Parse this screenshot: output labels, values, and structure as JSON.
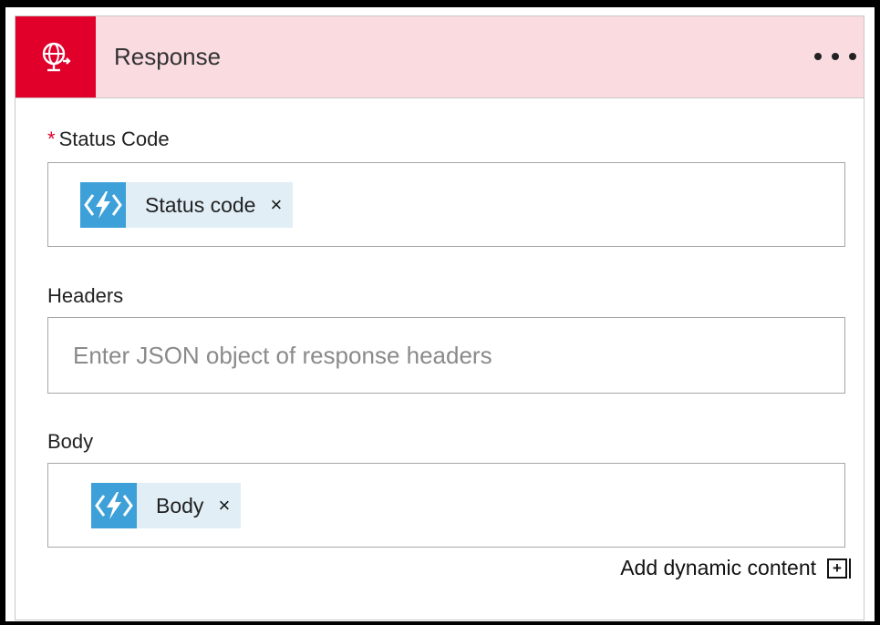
{
  "header": {
    "title": "Response",
    "icon": "globe-response-icon",
    "accent_color": "#e0002a",
    "background_color": "#f9dbe0"
  },
  "fields": {
    "status_code": {
      "required_marker": "*",
      "label": "Status Code",
      "token_label": "Status code",
      "token_remove": "×"
    },
    "headers": {
      "label": "Headers",
      "placeholder": "Enter JSON object of response headers"
    },
    "body": {
      "label": "Body",
      "token_label": "Body",
      "token_remove": "×"
    }
  },
  "footer": {
    "add_dynamic_content": "Add dynamic content",
    "add_icon": "+"
  }
}
